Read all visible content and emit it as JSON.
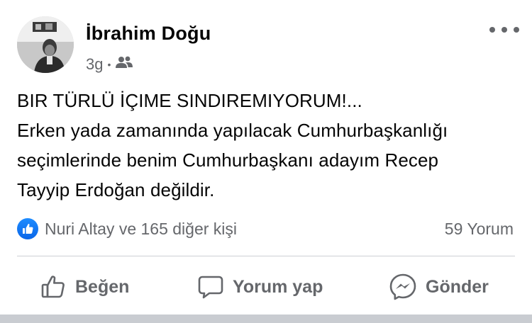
{
  "author": {
    "name": "İbrahim Doğu",
    "time": "3g",
    "privacy_icon": "friends-icon"
  },
  "post": {
    "lines": [
      "BIR TÜRLÜ İÇIME SINDIREMIYORUM!...",
      "Erken yada zamanında yapılacak Cumhurbaşkanlığı",
      "seçimlerinde benim Cumhurbaşkanı adayım Recep",
      "Tayyip Erdoğan değildir."
    ]
  },
  "reactions": {
    "icon": "like-icon",
    "summary": "Nuri Altay ve 165 diğer kişi",
    "comments": "59 Yorum"
  },
  "actions": {
    "like": "Beğen",
    "comment": "Yorum yap",
    "send": "Gönder"
  },
  "colors": {
    "accent": "#1877f2",
    "secondary_text": "#65676b",
    "divider": "#ced0d4"
  }
}
